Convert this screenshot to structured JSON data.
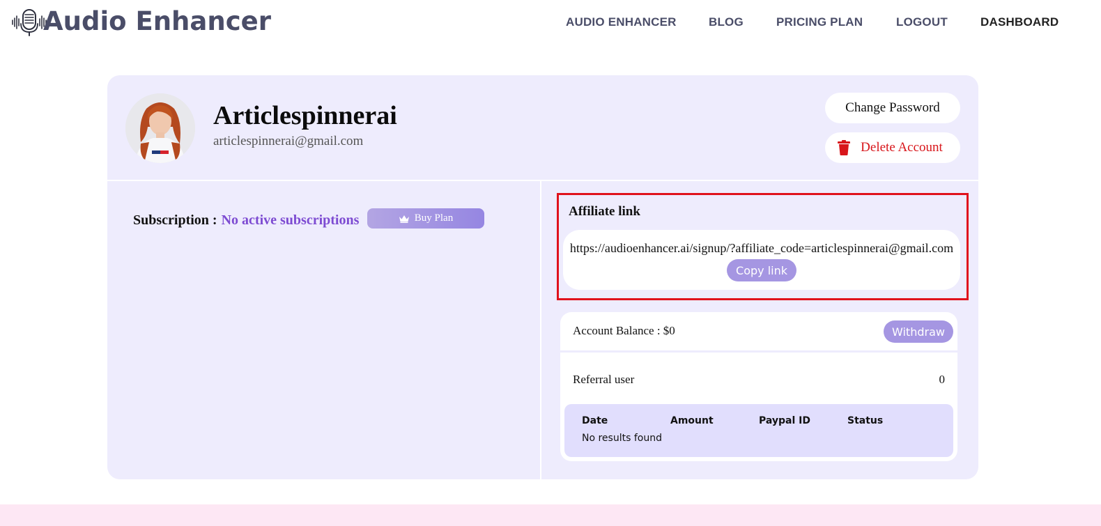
{
  "app": {
    "name": "Audio Enhancer",
    "logo_icon": "microphone-waveform-icon"
  },
  "nav": {
    "items": [
      {
        "label": "AUDIO ENHANCER"
      },
      {
        "label": "BLOG"
      },
      {
        "label": "PRICING PLAN"
      },
      {
        "label": "LOGOUT"
      },
      {
        "label": "DASHBOARD",
        "active": true
      }
    ]
  },
  "profile": {
    "name": "Articlespinnerai",
    "email": "articlespinnerai@gmail.com",
    "change_password_label": "Change Password",
    "delete_account_label": "Delete Account",
    "delete_icon": "trash-icon"
  },
  "subscription": {
    "label": "Subscription :",
    "value": "No active subscriptions",
    "buy_label": "Buy Plan",
    "buy_icon": "crown-icon"
  },
  "affiliate": {
    "title": "Affiliate link",
    "link": "https://audioenhancer.ai/signup/?affiliate_code=articlespinnerai@gmail.com",
    "copy_label": "Copy link"
  },
  "account": {
    "balance_label": "Account Balance : $0",
    "withdraw_label": "Withdraw",
    "referral_label": "Referral user",
    "referral_value": "0",
    "table": {
      "headers": [
        "Date",
        "Amount",
        "Paypal ID",
        "Status"
      ],
      "empty_text": "No results found"
    }
  },
  "colors": {
    "card_bg": "#eeecfd",
    "accent": "#a596e2",
    "subscription_text": "#7d4bd2",
    "delete_red": "#d8161b",
    "highlight_border": "#e0121c",
    "footer_band": "#fde7f4",
    "nav_text": "#4a4d68"
  }
}
